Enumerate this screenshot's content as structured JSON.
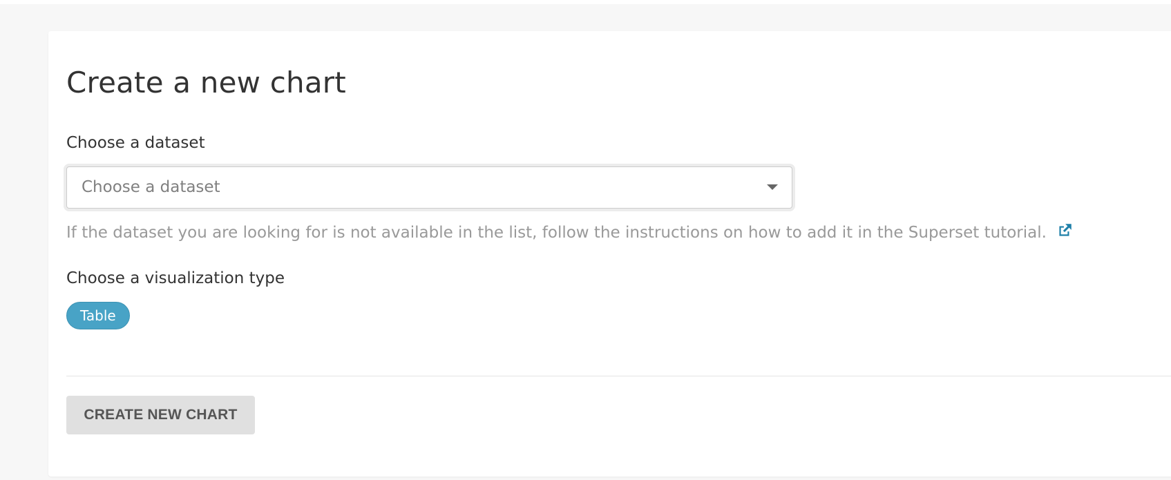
{
  "page": {
    "title": "Create a new chart"
  },
  "dataset": {
    "label": "Choose a dataset",
    "placeholder": "Choose a dataset",
    "selected_value": "",
    "help_text": "If the dataset you are looking for is not available in the list, follow the instructions on how to add it in the Superset tutorial.",
    "help_link_icon": "external-link-icon"
  },
  "visualization": {
    "label": "Choose a visualization type",
    "selected_type": "Table"
  },
  "actions": {
    "create_label": "CREATE NEW CHART",
    "create_enabled": false
  },
  "colors": {
    "accent": "#48a3c6",
    "link": "#1d7fa8",
    "button_disabled_bg": "#e0e0e0",
    "help_text": "#999999"
  }
}
